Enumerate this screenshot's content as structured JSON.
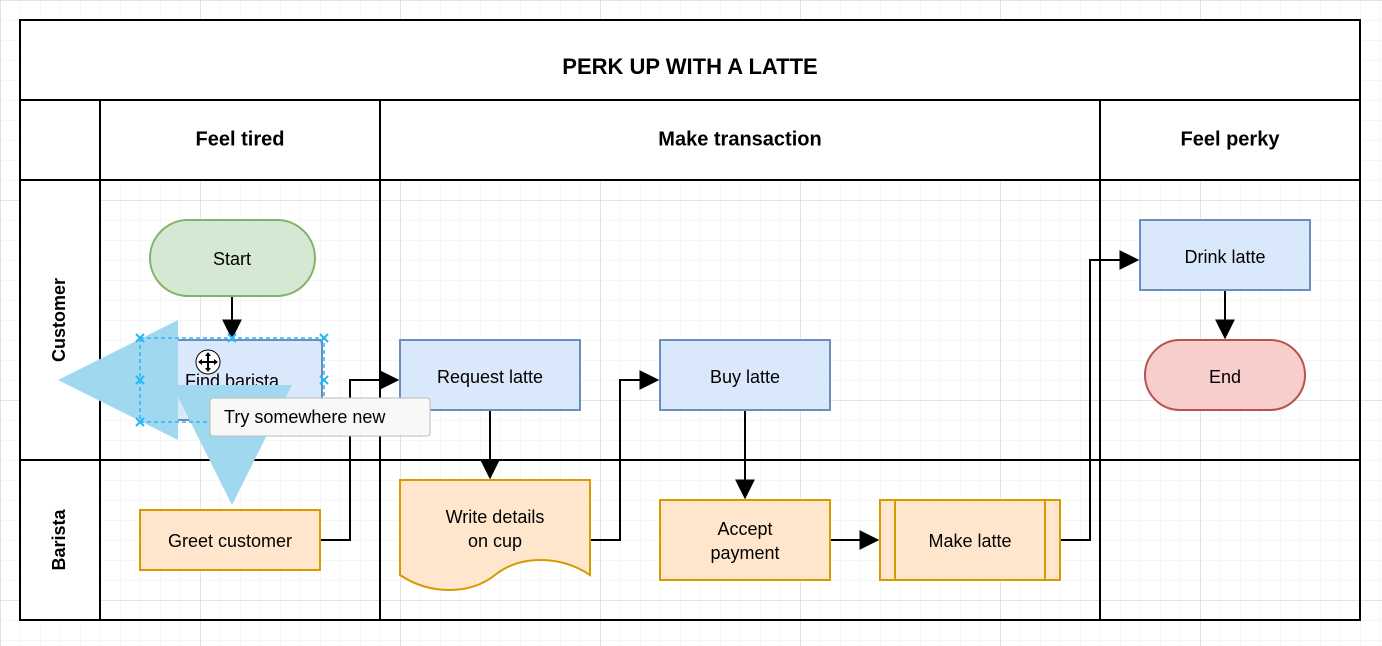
{
  "title": "PERK UP WITH A LATTE",
  "phases": {
    "feel_tired": "Feel tired",
    "make_transaction": "Make transaction",
    "feel_perky": "Feel perky"
  },
  "lanes": {
    "customer": "Customer",
    "barista": "Barista"
  },
  "nodes": {
    "start": "Start",
    "find_barista": "Find barista",
    "greet_customer": "Greet customer",
    "request_latte": "Request latte",
    "write_details": "Write details",
    "on_cup": "on cup",
    "buy_latte": "Buy latte",
    "accept": "Accept",
    "payment": "payment",
    "make_latte": "Make latte",
    "drink_latte": "Drink latte",
    "end": "End"
  },
  "tooltip": "Try somewhere new",
  "grid": {
    "cell": 40
  },
  "colors": {
    "green_fill": "#d5e8d4",
    "green_stroke": "#82b366",
    "blue_fill": "#dae8fc",
    "blue_stroke": "#6c8ebf",
    "orange_fill": "#ffe6cc",
    "orange_stroke": "#d79b00",
    "red_fill": "#f8cecc",
    "red_stroke": "#b85450",
    "sel_blue": "#29b6f6",
    "arrow_ghost": "#a0d8ef"
  }
}
